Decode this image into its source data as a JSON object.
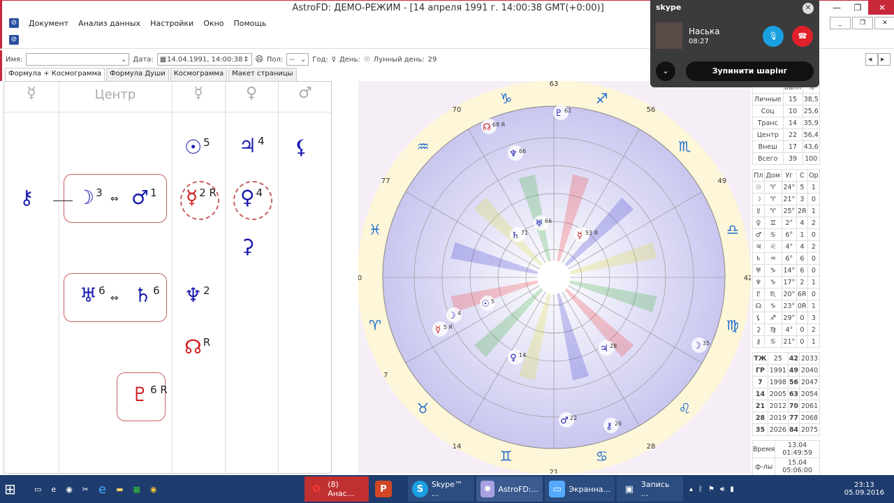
{
  "window": {
    "title": "AstroFD: ДЕМО-РЕЖИМ - [14 апреля 1991 г. 14:00:38 GMT(+0:00)]"
  },
  "menu": [
    "Документ",
    "Анализ данных",
    "Настройки",
    "Окно",
    "Помощь"
  ],
  "fields": {
    "name_label": "Имя:",
    "name_value": "",
    "date_label": "Дата:",
    "date_value": "14.04.1991, 14:00:38",
    "sex_label": "Пол:",
    "sex_value": "--",
    "year_label": "Год:",
    "year_glyph": "☿",
    "day_label": "День:",
    "day_glyph": "☉",
    "lunar_label": "Лунный день:",
    "lunar_value": "29"
  },
  "tabs": [
    "Формула + Космограмма",
    "Формула Души",
    "Космограмма",
    "Макет страницы"
  ],
  "formula": {
    "headers": [
      "☿",
      "Центр",
      "☿",
      "♀",
      "♂"
    ],
    "items": [
      {
        "g": "☉",
        "n": "5"
      },
      {
        "g": "♃",
        "n": "4"
      },
      {
        "g": "⚸",
        "n": ""
      },
      {
        "g": "⚷",
        "n": ""
      },
      {
        "g": "☽",
        "n": "3"
      },
      {
        "g": "♂",
        "n": "1"
      },
      {
        "g": "☿",
        "n": "2 R"
      },
      {
        "g": "♀",
        "n": "4"
      },
      {
        "g": "⚳",
        "n": ""
      },
      {
        "g": "♅",
        "n": "6"
      },
      {
        "g": "♄",
        "n": "6"
      },
      {
        "g": "♆",
        "n": "2"
      },
      {
        "g": "☊",
        "n": "R"
      },
      {
        "g": "♇",
        "n": "6 R"
      }
    ]
  },
  "chart": {
    "signs": [
      "♈",
      "♉",
      "♊",
      "♋",
      "♌",
      "♍",
      "♎",
      "♏",
      "♐",
      "♑",
      "♒",
      "♓"
    ],
    "ages": [
      "0",
      "7",
      "14",
      "21",
      "28",
      "42",
      "49",
      "56",
      "63",
      "70",
      "77"
    ],
    "planets": [
      {
        "g": "♇",
        "n": "62"
      },
      {
        "g": "☊",
        "n": "68 R"
      },
      {
        "g": "♆",
        "n": "66"
      },
      {
        "g": "♄",
        "n": "71"
      },
      {
        "g": "♅",
        "n": "66"
      },
      {
        "g": "☿",
        "n": "53 R"
      },
      {
        "g": "☉",
        "n": "5"
      },
      {
        "g": "☽",
        "n": "4"
      },
      {
        "g": "☿",
        "n": "5 R"
      },
      {
        "g": "♀",
        "n": "14"
      },
      {
        "g": "♃",
        "n": "28"
      },
      {
        "g": "☽",
        "n": "35"
      },
      {
        "g": "♂",
        "n": "22"
      },
      {
        "g": "⚷",
        "n": "26"
      }
    ]
  },
  "stats": {
    "header": [
      "",
      "Балл",
      "%"
    ],
    "rows": [
      [
        "Личные",
        "15",
        "38,5"
      ],
      [
        "Соц",
        "10",
        "25,6"
      ],
      [
        "Транс",
        "14",
        "35,9"
      ],
      [
        "Центр",
        "22",
        "56,4"
      ],
      [
        "Внеш",
        "17",
        "43,6"
      ],
      [
        "Всего",
        "39",
        "100"
      ]
    ]
  },
  "positions": {
    "header": [
      "Пл",
      "Дом",
      "Уг",
      "С",
      "Ор"
    ],
    "rows": [
      [
        "☉",
        "♈",
        "24°",
        "5",
        "1"
      ],
      [
        "☽",
        "♈",
        "21°",
        "3",
        "0"
      ],
      [
        "☿",
        "♈",
        "25°",
        "2R",
        "1"
      ],
      [
        "♀",
        "♊",
        "2°",
        "4",
        "2"
      ],
      [
        "♂",
        "♋",
        "6°",
        "1",
        "0"
      ],
      [
        "♃",
        "♌",
        "4°",
        "4",
        "2"
      ],
      [
        "♄",
        "♒",
        "6°",
        "6",
        "0"
      ],
      [
        "♅",
        "♑",
        "14°",
        "6",
        "0"
      ],
      [
        "♆",
        "♑",
        "17°",
        "2",
        "1"
      ],
      [
        "♇",
        "♏",
        "20°",
        "6R",
        "0"
      ],
      [
        "☊",
        "♑",
        "23°",
        "0R",
        "1"
      ],
      [
        "⚸",
        "♐",
        "29°",
        "0",
        "3"
      ],
      [
        "⚳",
        "♍",
        "4°",
        "0",
        "2"
      ],
      [
        "⚷",
        "♋",
        "21°",
        "0",
        "1"
      ]
    ]
  },
  "cycles": [
    [
      "ТЖ",
      "25",
      "42",
      "2033"
    ],
    [
      "ГР",
      "1991",
      "49",
      "2040"
    ],
    [
      "7",
      "1998",
      "56",
      "2047"
    ],
    [
      "14",
      "2005",
      "63",
      "2054"
    ],
    [
      "21",
      "2012",
      "70",
      "2061"
    ],
    [
      "28",
      "2019",
      "77",
      "2068"
    ],
    [
      "35",
      "2026",
      "84",
      "2075"
    ]
  ],
  "times": [
    [
      "Время",
      "13.04 01:49:59"
    ],
    [
      "ф-лы",
      "15.04 05:06:00"
    ]
  ],
  "skype": {
    "logo": "skype",
    "name": "Наська",
    "duration": "08:27",
    "stop_label": "Зупинити шарінг"
  },
  "taskbar": {
    "items": [
      "(8) Анас...",
      "",
      "Skype™ ...",
      "AstroFD:...",
      "Экранна...",
      "Запись ..."
    ],
    "time": "23:13",
    "date": "05.09.2016"
  },
  "colors": {
    "accent": "#c8283a",
    "planet": "#1a1ab0",
    "retro": "#d01818",
    "taskbar": "#1f3c6e",
    "skype_mic": "#1aa0e0",
    "skype_end": "#e0202a"
  }
}
